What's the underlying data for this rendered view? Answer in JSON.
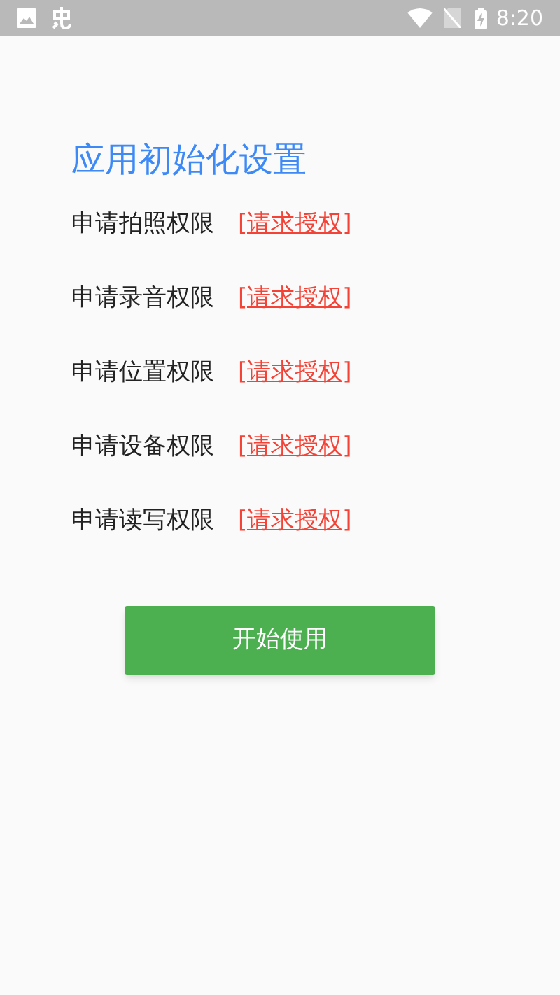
{
  "status_bar": {
    "time": "8:20"
  },
  "title": "应用初始化设置",
  "permissions": [
    {
      "label": "申请拍照权限",
      "action": "[请求授权]"
    },
    {
      "label": "申请录音权限",
      "action": "[请求授权]"
    },
    {
      "label": "申请位置权限",
      "action": "[请求授权]"
    },
    {
      "label": "申请设备权限",
      "action": "[请求授权]"
    },
    {
      "label": "申请读写权限",
      "action": "[请求授权]"
    }
  ],
  "button": "开始使用"
}
